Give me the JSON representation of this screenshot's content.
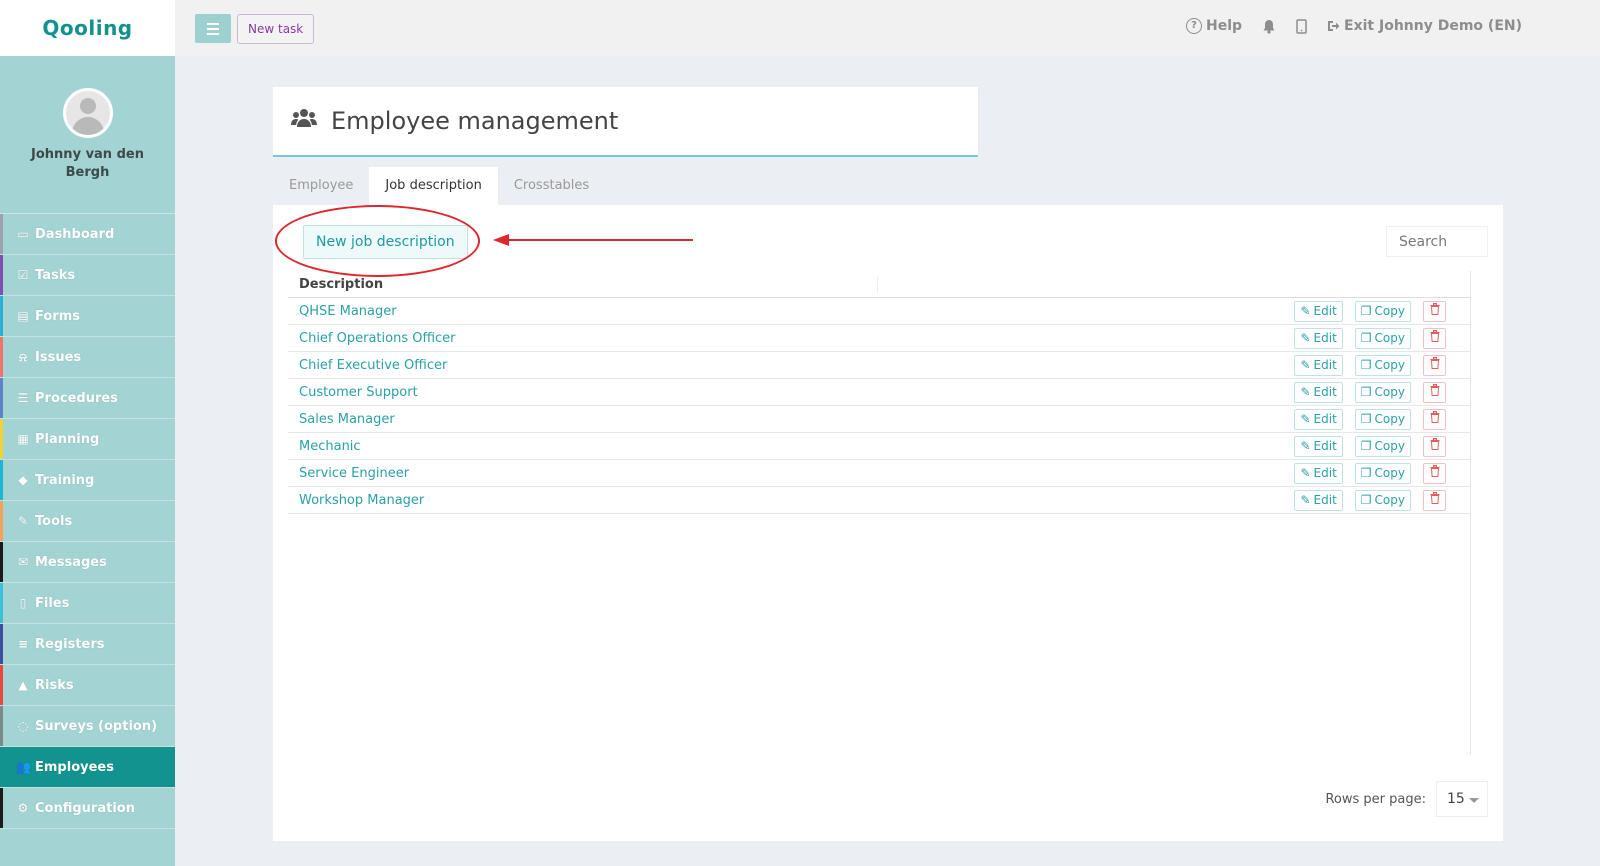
{
  "app": {
    "logo": "Qooling"
  },
  "user": {
    "name": "Johnny van den Bergh"
  },
  "nav": [
    {
      "label": "Dashboard",
      "icon": "monitor-icon",
      "glyph": "▭",
      "color": "#9aa3ad"
    },
    {
      "label": "Tasks",
      "icon": "check-square-icon",
      "glyph": "☑",
      "color": "#7d4fb3"
    },
    {
      "label": "Forms",
      "icon": "file-icon",
      "glyph": "▤",
      "color": "#2ab0d6"
    },
    {
      "label": "Issues",
      "icon": "bell-icon",
      "glyph": "⍾",
      "color": "#f2736b"
    },
    {
      "label": "Procedures",
      "icon": "list-icon",
      "glyph": "☰",
      "color": "#5c84c8"
    },
    {
      "label": "Planning",
      "icon": "calendar-icon",
      "glyph": "▦",
      "color": "#f3d13b"
    },
    {
      "label": "Training",
      "icon": "graduation-cap-icon",
      "glyph": "◆",
      "color": "#1fb4d1"
    },
    {
      "label": "Tools",
      "icon": "wrench-icon",
      "glyph": "✎",
      "color": "#f3a25a"
    },
    {
      "label": "Messages",
      "icon": "envelope-icon",
      "glyph": "✉",
      "color": "#1b1b1b"
    },
    {
      "label": "Files",
      "icon": "document-icon",
      "glyph": "▯",
      "color": "#3dbfd8"
    },
    {
      "label": "Registers",
      "icon": "bars-icon",
      "glyph": "≡",
      "color": "#3d4e9e"
    },
    {
      "label": "Risks",
      "icon": "warning-icon",
      "glyph": "▲",
      "color": "#e9483f"
    },
    {
      "label": "Surveys (option)",
      "icon": "comment-icon",
      "glyph": "◌",
      "color": "#7a8a8a"
    },
    {
      "label": "Employees",
      "icon": "users-icon",
      "glyph": "👥",
      "color": "#12938f",
      "active": true
    },
    {
      "label": "Configuration",
      "icon": "gear-icon",
      "glyph": "⚙",
      "color": "#1b1b1b"
    }
  ],
  "topbar": {
    "new_task": "New task",
    "help": "Help",
    "exit": "Exit Johnny Demo (EN)"
  },
  "page": {
    "title": "Employee management",
    "tabs": [
      {
        "label": "Employee",
        "active": false
      },
      {
        "label": "Job description",
        "active": true
      },
      {
        "label": "Crosstables",
        "active": false
      }
    ],
    "new_button": "New job description",
    "search_placeholder": "Search",
    "column_header": "Description",
    "rows": [
      "QHSE Manager",
      "Chief Operations Officer",
      "Chief Executive Officer",
      "Customer Support",
      "Sales Manager",
      "Mechanic",
      "Service Engineer",
      "Workshop Manager"
    ],
    "edit_label": "Edit",
    "copy_label": "Copy",
    "rows_per_page_label": "Rows per page:",
    "rows_per_page_value": "15"
  },
  "colors": {
    "accent": "#12938f",
    "annotation": "#e0262d",
    "link": "#2aa1a6"
  }
}
